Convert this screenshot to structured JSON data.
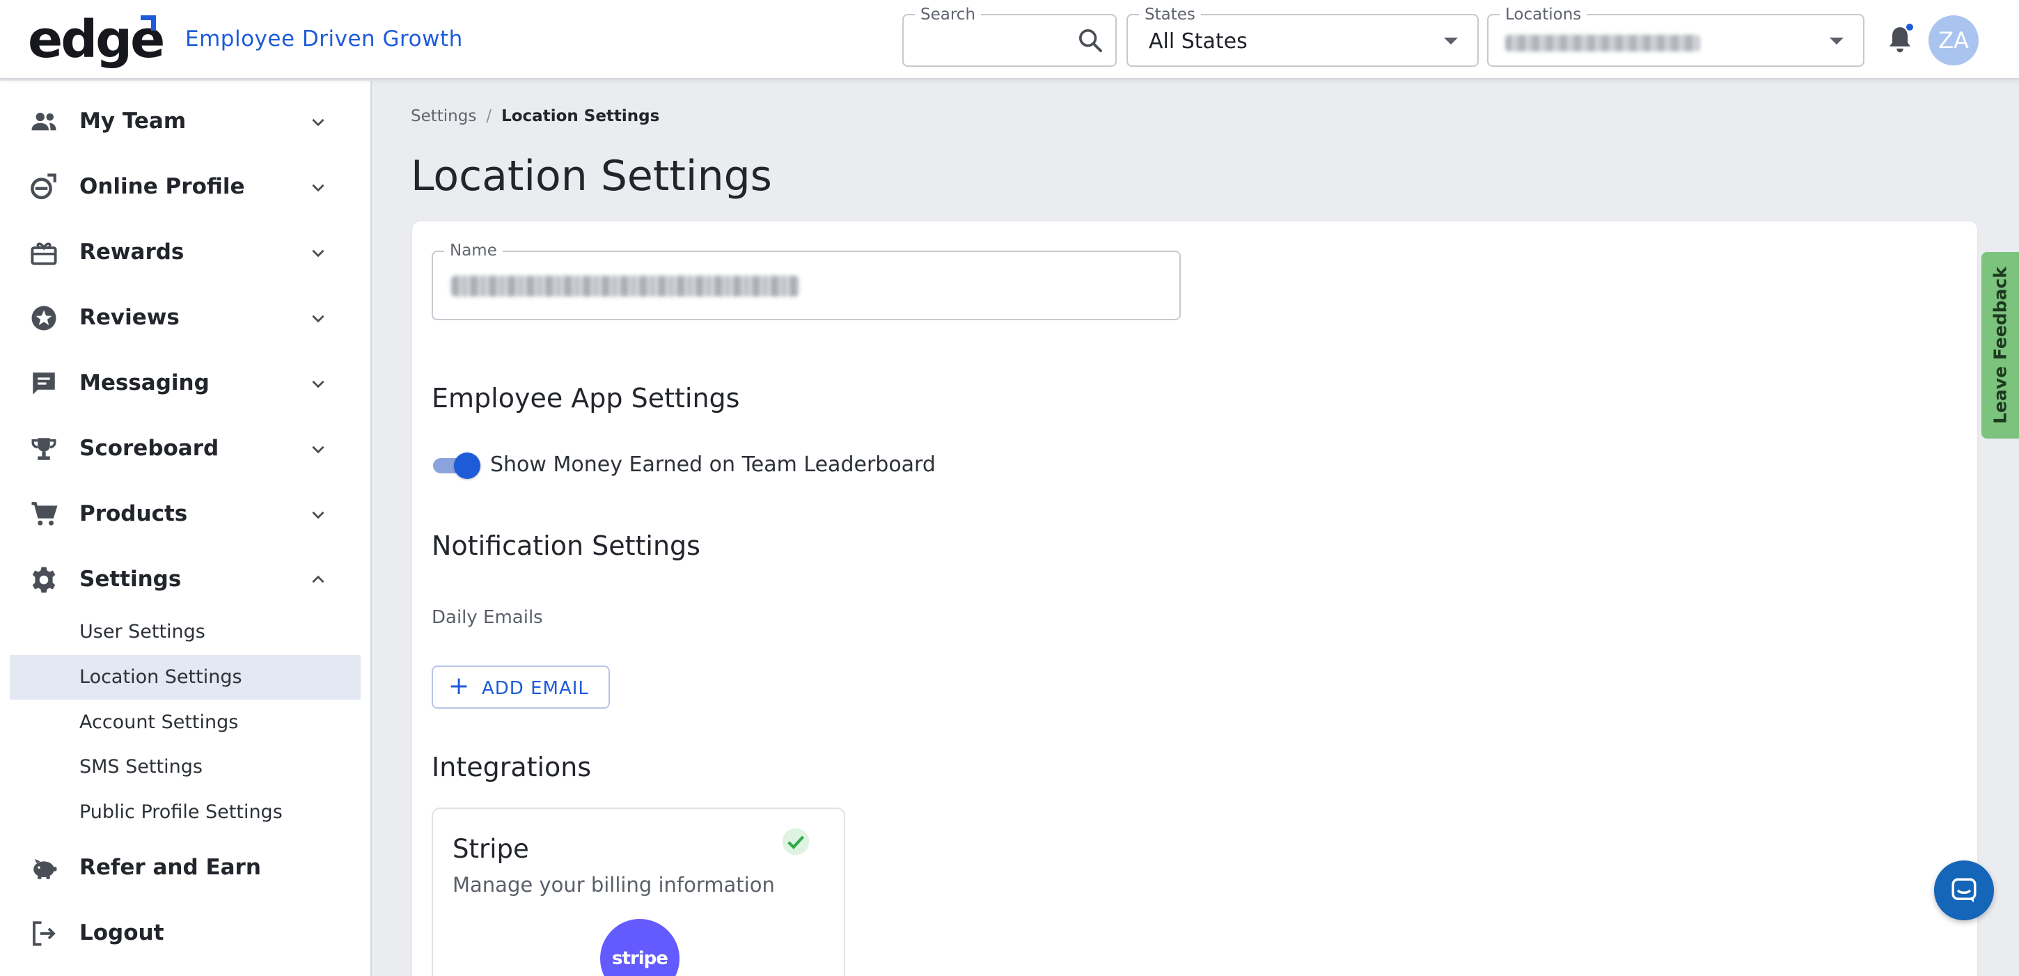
{
  "header": {
    "logo": "edge",
    "tagline": "Employee Driven Growth",
    "search": {
      "label": "Search",
      "value": ""
    },
    "states": {
      "label": "States",
      "value": "All States"
    },
    "locations": {
      "label": "Locations"
    },
    "avatar_initials": "ZA",
    "accent_color": "#1e5bd8"
  },
  "sidebar": {
    "items": [
      {
        "label": "My Team",
        "icon": "team-icon"
      },
      {
        "label": "Online Profile",
        "icon": "online-profile-icon"
      },
      {
        "label": "Rewards",
        "icon": "gift-icon"
      },
      {
        "label": "Reviews",
        "icon": "star-badge-icon"
      },
      {
        "label": "Messaging",
        "icon": "message-icon"
      },
      {
        "label": "Scoreboard",
        "icon": "trophy-icon"
      },
      {
        "label": "Products",
        "icon": "cart-icon"
      },
      {
        "label": "Settings",
        "icon": "gear-icon"
      }
    ],
    "settings_sub": [
      {
        "label": "User Settings"
      },
      {
        "label": "Location Settings",
        "active": true
      },
      {
        "label": "Account Settings"
      },
      {
        "label": "SMS Settings"
      },
      {
        "label": "Public Profile Settings"
      }
    ],
    "bottom_items": [
      {
        "label": "Refer and Earn",
        "icon": "piggy-bank-icon"
      },
      {
        "label": "Logout",
        "icon": "logout-icon"
      }
    ]
  },
  "breadcrumb": {
    "parent": "Settings",
    "separator": "/",
    "current": "Location Settings"
  },
  "page": {
    "title": "Location Settings",
    "name_label": "Name",
    "employee_app_title": "Employee App Settings",
    "toggle_label": "Show Money Earned on Team Leaderboard",
    "toggle_on": true,
    "notification_title": "Notification Settings",
    "daily_emails_label": "Daily Emails",
    "add_email_label": "ADD EMAIL",
    "integrations_title": "Integrations",
    "stripe": {
      "title": "Stripe",
      "description": "Manage your billing information",
      "logo_text": "stripe",
      "connected": true,
      "brand_color": "#635bff"
    }
  },
  "feedback_tab": {
    "label": "Leave Feedback",
    "color": "#7cc47e"
  }
}
